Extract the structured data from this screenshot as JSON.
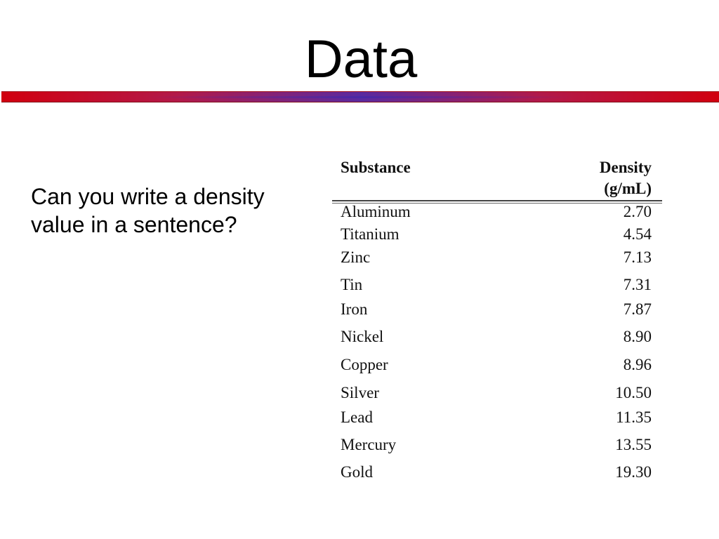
{
  "slide": {
    "title": "Data",
    "question": "Can you write a density value in a sentence?"
  },
  "colors": {
    "divider_edge": "#d1000f",
    "divider_center": "#5a2aa0",
    "text": "#000000"
  },
  "table": {
    "headers": {
      "substance": "Substance",
      "density_line1": "Density",
      "density_line2": "(g/mL)"
    },
    "rows": [
      {
        "substance": "Aluminum",
        "density": "2.70"
      },
      {
        "substance": "Titanium",
        "density": "4.54"
      },
      {
        "substance": "Zinc",
        "density": "7.13"
      },
      {
        "substance": "Tin",
        "density": "7.31"
      },
      {
        "substance": "Iron",
        "density": "7.87"
      },
      {
        "substance": "Nickel",
        "density": "8.90"
      },
      {
        "substance": "Copper",
        "density": "8.96"
      },
      {
        "substance": "Silver",
        "density": "10.50"
      },
      {
        "substance": "Lead",
        "density": "11.35"
      },
      {
        "substance": "Mercury",
        "density": "13.55"
      },
      {
        "substance": "Gold",
        "density": "19.30"
      }
    ]
  }
}
